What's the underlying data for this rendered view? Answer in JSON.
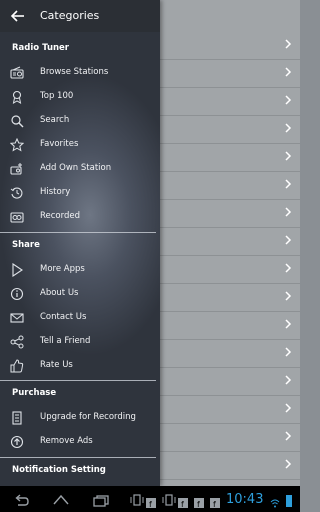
{
  "header": {
    "title": "Categories"
  },
  "sections": {
    "radio_tuner": "Radio Tuner",
    "share": "Share",
    "purchase": "Purchase",
    "notification": "Notification Setting"
  },
  "menu": {
    "browse": "Browse Stations",
    "top100": "Top 100",
    "search": "Search",
    "favorites": "Favorites",
    "add_own": "Add Own Station",
    "history": "History",
    "recorded": "Recorded",
    "more_apps": "More Apps",
    "about": "About Us",
    "contact": "Contact Us",
    "tell_friend": "Tell a Friend",
    "rate": "Rate Us",
    "upgrade": "Upgrade for Recording",
    "remove_ads": "Remove Ads"
  },
  "status": {
    "time": "10:43"
  },
  "colors": {
    "accent_clock": "#2e9fdc",
    "drawer_bg": "#3b414c"
  }
}
